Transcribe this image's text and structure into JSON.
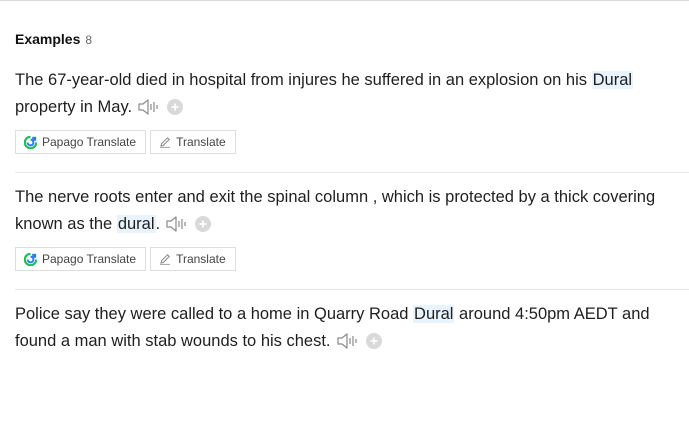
{
  "section": {
    "title": "Examples",
    "count": "8"
  },
  "buttons": {
    "papago_label": "Papago Translate",
    "translate_label": "Translate"
  },
  "examples": [
    {
      "before": "The 67-year-old died in hospital from injures he suffered in an explosion on his ",
      "keyword": "Dural",
      "after": " property in May."
    },
    {
      "before": "The nerve roots enter and exit the spinal column , which is protected by a thick covering known as the ",
      "keyword": "dural",
      "after": "."
    },
    {
      "before": "Police say they were called to a home in Quarry Road ",
      "keyword": "Dural",
      "after": " around 4:50pm AEDT and found a man with stab wounds to his chest."
    }
  ],
  "icons": {
    "speaker": "speaker-icon",
    "add": "plus-circle-icon",
    "papago": "papago-logo-icon",
    "translate": "pencil-icon"
  },
  "colors": {
    "highlight": "#e8f3fd",
    "papago_green": "#1fbd5c",
    "papago_blue": "#2f7ee8"
  }
}
